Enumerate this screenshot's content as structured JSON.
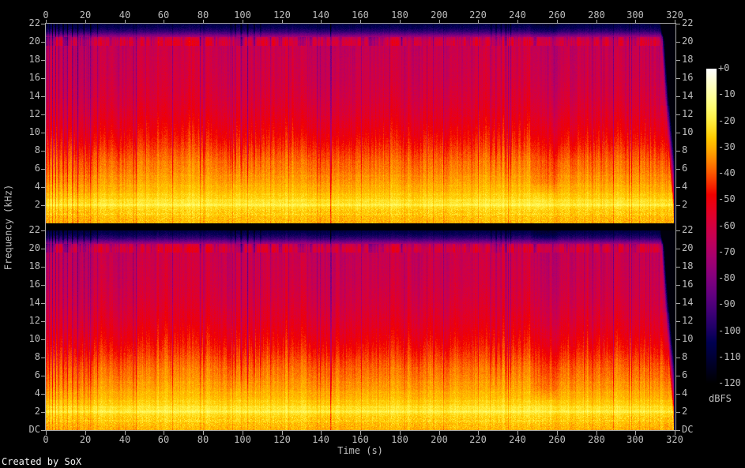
{
  "figure": {
    "credit": "Created by SoX",
    "x_axis_label": "Time (s)",
    "y_axis_label": "Frequency (kHz)",
    "colorbar_label": "dBFS"
  },
  "chart_data": {
    "type": "heatmap",
    "subtype": "audio-spectrogram",
    "tool": "SoX",
    "channels": [
      "left",
      "right"
    ],
    "x_axis": {
      "label": "Time (s)",
      "min": 0,
      "max": 322,
      "ticks": [
        0,
        20,
        40,
        60,
        80,
        100,
        120,
        140,
        160,
        180,
        200,
        220,
        240,
        260,
        280,
        300,
        320
      ],
      "ticks_shown": "top and bottom"
    },
    "y_axis": {
      "label": "Frequency (kHz)",
      "max": 22,
      "min_label": "DC",
      "ticks": [
        22,
        20,
        18,
        16,
        14,
        12,
        10,
        8,
        6,
        4,
        2
      ],
      "dc_label": "DC",
      "ticks_shown": "left and right, both panels"
    },
    "colorbar": {
      "label": "dBFS",
      "ticks": [
        "+0",
        "-10",
        "-20",
        "-30",
        "-40",
        "-50",
        "-60",
        "-70",
        "-80",
        "-90",
        "-100",
        "-110",
        "-120"
      ],
      "range_db": [
        0,
        -120
      ],
      "palette_stops": [
        {
          "db": "+0",
          "hex": "#ffffff"
        },
        {
          "db": "-10",
          "hex": "#ffff9e"
        },
        {
          "db": "-20",
          "hex": "#ffec3e"
        },
        {
          "db": "-30",
          "hex": "#ffb000"
        },
        {
          "db": "-40",
          "hex": "#fb5500"
        },
        {
          "db": "-50",
          "hex": "#ec000b"
        },
        {
          "db": "-60",
          "hex": "#d20040"
        },
        {
          "db": "-70",
          "hex": "#ae0068"
        },
        {
          "db": "-80",
          "hex": "#81007e"
        },
        {
          "db": "-90",
          "hex": "#4f007b"
        },
        {
          "db": "-100",
          "hex": "#180062"
        },
        {
          "db": "-110",
          "hex": "#000036"
        },
        {
          "db": "-120",
          "hex": "#000000"
        }
      ]
    },
    "spectral_envelope_db": [
      [
        0,
        -30
      ],
      [
        0.3,
        -29
      ],
      [
        0.8,
        -27.5
      ],
      [
        1.3,
        -26
      ],
      [
        1.8,
        -23.5
      ],
      [
        2.15,
        -21
      ],
      [
        2.5,
        -23
      ],
      [
        3,
        -26
      ],
      [
        3.6,
        -28.5
      ],
      [
        4.5,
        -31.5
      ],
      [
        5.5,
        -34.5
      ],
      [
        6.5,
        -37
      ],
      [
        7.5,
        -40
      ],
      [
        8.5,
        -44
      ],
      [
        9.5,
        -47.5
      ],
      [
        10.5,
        -50.5
      ],
      [
        12,
        -54.5
      ],
      [
        14,
        -58.5
      ],
      [
        16,
        -61
      ],
      [
        18,
        -62.5
      ],
      [
        19.5,
        -63.5
      ],
      [
        20.1,
        -64
      ],
      [
        20.5,
        -70
      ],
      [
        20.9,
        -86
      ],
      [
        21.2,
        -96
      ],
      [
        21.6,
        -103
      ],
      [
        22,
        -107
      ]
    ],
    "harmonic_bands": [
      [
        1.05,
        0.1,
        2.5
      ],
      [
        2.05,
        0.12,
        4
      ],
      [
        2.6,
        0.1,
        2.5
      ],
      [
        3.25,
        0.11,
        1.6
      ],
      [
        4.2,
        0.12,
        1.3
      ],
      [
        5.3,
        0.12,
        1.1
      ],
      [
        6.8,
        0.12,
        0.8
      ]
    ],
    "events": {
      "intro_gaps": [
        [
          0.5,
          0.22,
          -26
        ],
        [
          1.8,
          0.25,
          -25
        ],
        [
          3.2,
          0.28,
          -24
        ],
        [
          4.8,
          0.3,
          -26
        ],
        [
          6.6,
          0.32,
          -24
        ],
        [
          8.7,
          0.35,
          -25
        ],
        [
          11.0,
          0.35,
          -22
        ],
        [
          13.4,
          0.38,
          -24
        ],
        [
          16.2,
          0.4,
          -22
        ],
        [
          19.3,
          0.4,
          -23
        ],
        [
          22.8,
          0.4,
          -20
        ],
        [
          26.2,
          0.35,
          -16
        ]
      ],
      "breakdown_bands": [
        [
          94.6,
          0.5,
          -13
        ],
        [
          96.9,
          0.6,
          -15
        ],
        [
          99.8,
          0.7,
          -14
        ],
        [
          103.2,
          0.65,
          -16
        ],
        [
          106.6,
          0.6,
          -13
        ],
        [
          109.8,
          0.5,
          -11
        ],
        [
          228.0,
          0.45,
          -10
        ],
        [
          230.4,
          0.5,
          -12
        ],
        [
          232.9,
          0.45,
          -11
        ],
        [
          235.4,
          0.5,
          -12
        ],
        [
          237.9,
          0.45,
          -11
        ]
      ],
      "track_markers": [
        [
          145.5,
          0.28,
          -30
        ],
        [
          204.5,
          0.22,
          -24
        ]
      ],
      "quiet_regions": [
        [
          248,
          262,
          -4.5
        ]
      ],
      "codec_cutoff_khz": 20.4,
      "fade_out_start_s": 314,
      "end_time_s": 321.5
    },
    "noise": {
      "column_db": 5.5,
      "pixel_db": 3.2
    },
    "layout_hints": {
      "panels": 2,
      "grid": false,
      "colorbar_position": "right"
    }
  },
  "colors": {
    "background": "#000000",
    "axis_line": "#a8a8a8",
    "tick_label": "#bdbdbd",
    "credit_text": "#f2f2f2"
  }
}
